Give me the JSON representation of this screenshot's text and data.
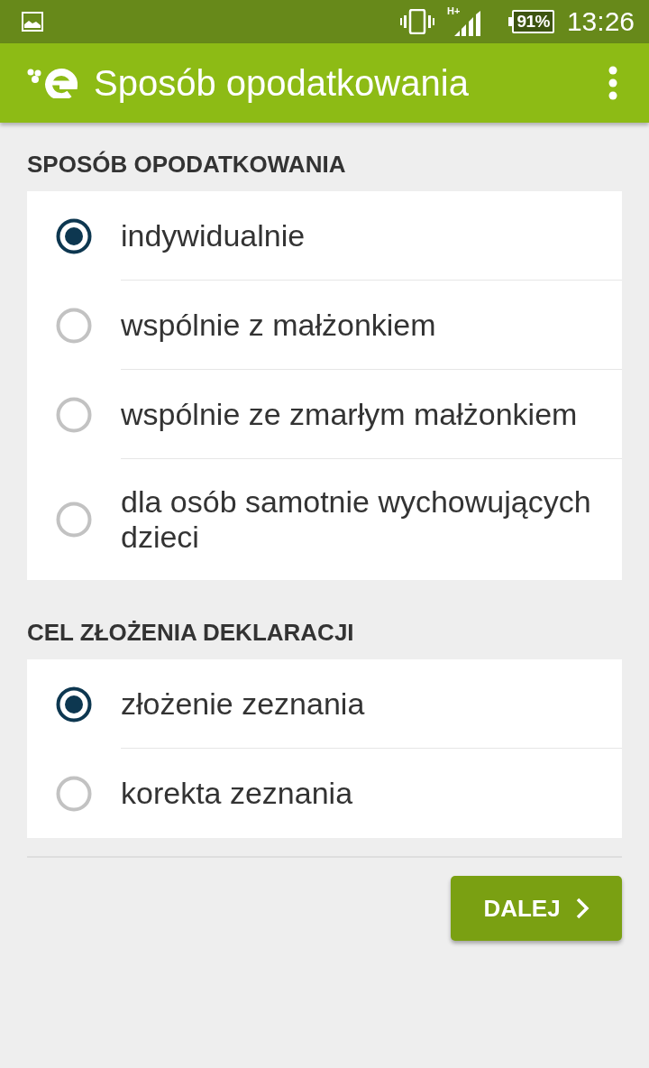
{
  "status_bar": {
    "network": "H+",
    "battery": "91%",
    "time": "13:26"
  },
  "app_bar": {
    "title": "Sposób opodatkowania"
  },
  "sections": [
    {
      "heading": "SPOSÓB OPODATKOWANIA",
      "options": [
        {
          "label": "indywidualnie",
          "selected": true
        },
        {
          "label": "wspólnie z małżonkiem",
          "selected": false
        },
        {
          "label": "wspólnie ze zmarłym małżonkiem",
          "selected": false
        },
        {
          "label": "dla osób samotnie wychowujących dzieci",
          "selected": false
        }
      ]
    },
    {
      "heading": "CEL ZŁOŻENIA DEKLARACJI",
      "options": [
        {
          "label": "złożenie zeznania",
          "selected": true
        },
        {
          "label": "korekta zeznania",
          "selected": false
        }
      ]
    }
  ],
  "next_button": {
    "label": "DALEJ"
  }
}
